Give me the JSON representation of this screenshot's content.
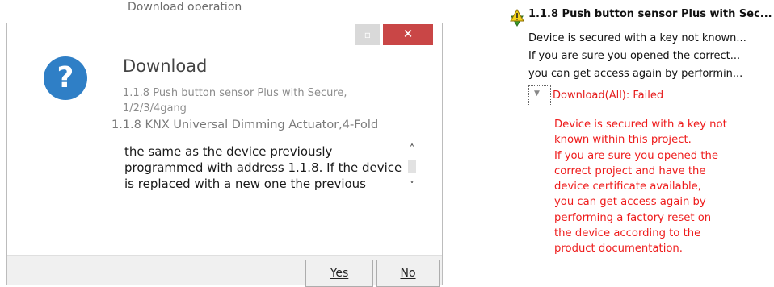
{
  "dialog": {
    "ghost_text": "Download operation",
    "restore_glyph": "▫",
    "close_glyph": "✕",
    "question_glyph": "?",
    "title": "Download",
    "message_line1": "1.1.8 Push button sensor Plus with Secure, 1/2/3/4gang",
    "message_line2": "1.1.8 KNX Universal Dimming Actuator,4-Fold",
    "textbox_lines": [
      "the same as the device previously",
      "programmed with address 1.1.8. If the device",
      "is replaced with a new one the previous"
    ],
    "scroll_up": "˄",
    "scroll_down": "˅",
    "yes_label": "Yes",
    "no_label": "No",
    "colors": {
      "close": "#c94646",
      "icon": "#2f7fc6"
    }
  },
  "tree": {
    "root_label": "1.1.8 Push button sensor Plus with Sec...",
    "root_lines": [
      "Device is secured with a key not known...",
      "If you are sure you opened the correct...",
      "you can get access again by performin..."
    ],
    "child_arrow": "▼",
    "child_label": "Download(All): Failed",
    "detail_lines": [
      "Device is secured with a key not",
      "known within this project.",
      "If you are sure you opened the",
      "correct project and have the",
      "device certificate available,",
      "you can get access again by",
      "performing a factory reset on",
      "the device according to the",
      "product documentation."
    ],
    "icons": [
      "warning-icon",
      "download-arrow-icon"
    ],
    "error_color": "#ee1c1c"
  }
}
